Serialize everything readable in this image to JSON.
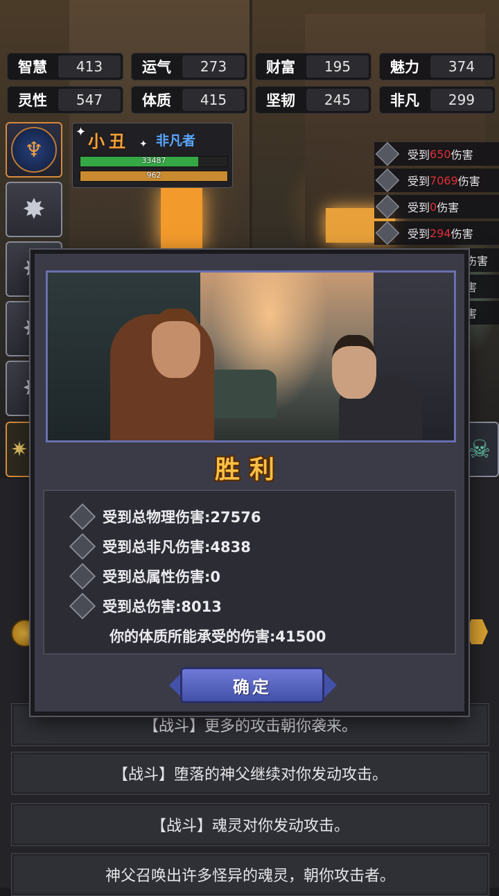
{
  "stats": [
    {
      "name": "智慧",
      "value": "413"
    },
    {
      "name": "运气",
      "value": "273"
    },
    {
      "name": "财富",
      "value": "195"
    },
    {
      "name": "魅力",
      "value": "374"
    },
    {
      "name": "灵性",
      "value": "547"
    },
    {
      "name": "体质",
      "value": "415"
    },
    {
      "name": "坚韧",
      "value": "245"
    },
    {
      "name": "非凡",
      "value": "299"
    }
  ],
  "character": {
    "name": "小丑",
    "title": "非凡者",
    "hp": "33487",
    "hp_fraction": 0.8,
    "mp": "962",
    "mp_fraction": 1.0
  },
  "damage_log": [
    {
      "prefix": "受到",
      "amount": "650",
      "suffix": "伤害"
    },
    {
      "prefix": "受到",
      "amount": "7069",
      "suffix": "伤害"
    },
    {
      "prefix": "受到",
      "amount": "0",
      "suffix": "伤害"
    },
    {
      "prefix": "受到",
      "amount": "294",
      "suffix": "伤害"
    }
  ],
  "damage_log_partial": [
    "伤害",
    "害",
    "害"
  ],
  "modal": {
    "title": "胜利",
    "lines": [
      "受到总物理伤害:27576",
      "受到总非凡伤害:4838",
      "受到总属性伤害:0",
      "受到总伤害:8013",
      "你的体质所能承受的伤害:41500"
    ],
    "confirm": "确定"
  },
  "battle_log": [
    "【战斗】更多的攻击朝你袭来。",
    "【战斗】堕落的神父继续对你发动攻击。",
    "【战斗】魂灵对你发动攻击。",
    "神父召唤出许多怪异的魂灵，朝你攻击者。"
  ],
  "colors": {
    "damage_amount": "#e0303a",
    "victory": "#f6c046",
    "char_title": "#5aa7ff",
    "char_name": "#f2a23e"
  }
}
